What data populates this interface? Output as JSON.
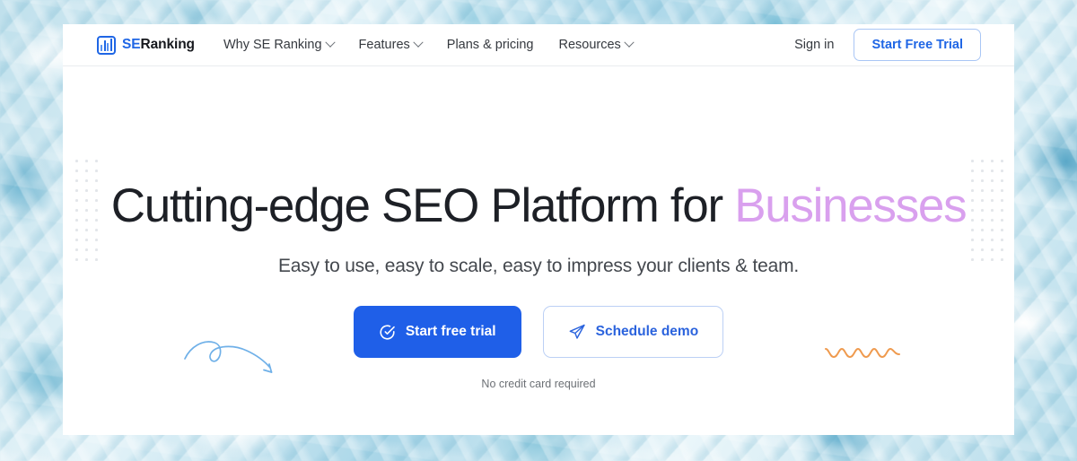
{
  "header": {
    "logo": {
      "icon": "bar-chart-logo-icon",
      "text_primary": "SE",
      "text_secondary": "Ranking"
    },
    "nav": [
      {
        "label": "Why SE Ranking",
        "has_dropdown": true
      },
      {
        "label": "Features",
        "has_dropdown": true
      },
      {
        "label": "Plans & pricing",
        "has_dropdown": false
      },
      {
        "label": "Resources",
        "has_dropdown": true
      }
    ],
    "signin_label": "Sign in",
    "cta_label": "Start Free Trial"
  },
  "hero": {
    "heading_plain": "Cutting-edge SEO Platform for ",
    "heading_accent": "Businesses",
    "subheading": "Easy to use, easy to scale, easy to impress your clients & team.",
    "primary_button": {
      "label": "Start free trial",
      "icon": "check-circle-icon"
    },
    "secondary_button": {
      "label": "Schedule demo",
      "icon": "paper-plane-icon"
    },
    "note": "No credit card required"
  },
  "decor": {
    "arrow_icon": "curved-loop-arrow-doodle",
    "squiggle_icon": "wavy-line-doodle",
    "dots_left_icon": "dot-grid-pattern",
    "dots_right_icon": "dot-grid-pattern"
  },
  "colors": {
    "brand_blue": "#1f66e5",
    "primary_button_bg": "#1f5fe8",
    "accent_purple": "#d9a0ee",
    "doodle_blue": "#6fb0e8",
    "doodle_orange": "#ef9a4e",
    "heading_dark": "#1d2026",
    "panel_bg": "#ffffff",
    "page_bg_water": "#a9d6e8"
  }
}
